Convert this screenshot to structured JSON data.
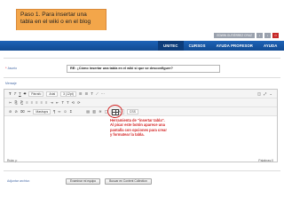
{
  "caption": {
    "line1": "Paso 1. Para insertar una",
    "line2": "tabla en el wiki o en el blog"
  },
  "userbar": {
    "name": "EDWIN GUTIÉRREZ CRUZ",
    "btn1": "▪",
    "btn2": "▪",
    "btn3": "⏻"
  },
  "nav": {
    "items": [
      "UNITEC",
      "CURSOS",
      "AYUDA PROFESOR",
      "AYUDA"
    ],
    "active": "UNITEC"
  },
  "form": {
    "title_label": "Asunto",
    "subject_value": "RE: ¿Cómo insertar una tabla en el wiki si que se desconfigure?",
    "message_label": "Mensaje"
  },
  "toolbar": {
    "row1": [
      "T",
      "T",
      "T",
      "T"
    ],
    "row1_style": "Párrafo",
    "row1_font": "Arial",
    "row1_size": "3 (12pt)",
    "row1_more": [
      "☰",
      "☰",
      "T",
      "⟋",
      "⋯"
    ],
    "row1_right": [
      "◫",
      "⤢",
      "⌄"
    ],
    "row2": [
      "✂",
      "⎘",
      "⎗",
      "≡",
      "≡",
      "≡",
      "≡",
      "≡",
      "⇥",
      "⇤",
      "T",
      "T",
      "⟲",
      "⟳"
    ],
    "row3": [
      "⊘",
      "⊘",
      "⌧",
      "⚯",
      "Mashups",
      "¶",
      "∞",
      "☺",
      "Σ",
      "▦",
      "▤",
      "▥",
      "≋",
      "▢",
      "HTML",
      "CSS"
    ]
  },
  "note": {
    "line1": "Herramienta de \"insertar tabla\".",
    "line2": "Al picar este botón aparece una",
    "line3": "pantalla con opciones para crear",
    "line4": "y formatear la tabla."
  },
  "editor_footer": {
    "path": "Ruta: p",
    "wordcount": "Palabras:0"
  },
  "attachments": {
    "label": "Adjuntar archivo",
    "browse_btn": "Examinar mi equipo",
    "collection_btn": "Buscar en Content Collection"
  },
  "colors": {
    "nav": "#1a5aa8",
    "callout": "#f3a64a",
    "annotation": "#d32222"
  }
}
